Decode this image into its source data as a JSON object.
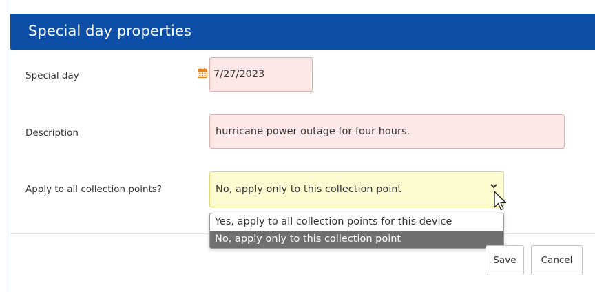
{
  "dialog": {
    "title": "Special day properties"
  },
  "form": {
    "special_day": {
      "label": "Special day",
      "value": "7/27/2023",
      "icon": "calendar-icon"
    },
    "description": {
      "label": "Description",
      "value": "hurricane power outage for four hours."
    },
    "apply_all": {
      "label": "Apply to all collection points?",
      "value": "No, apply only to this collection point",
      "options": [
        "Yes, apply to all collection points for this device",
        "No, apply only to this collection point"
      ],
      "selected_index": 1
    }
  },
  "footer": {
    "save_label": "Save",
    "cancel_label": "Cancel"
  },
  "colors": {
    "header": "#0d4fa6",
    "required_field": "#fde7e7",
    "focused_field": "#fdfbd0",
    "calendar_icon": "#e8821e"
  }
}
